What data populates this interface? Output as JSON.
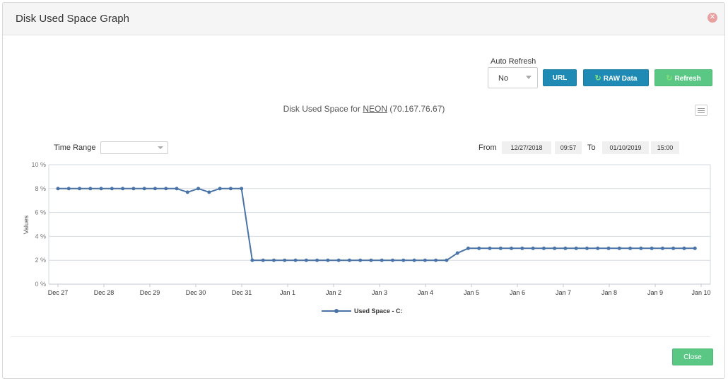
{
  "dialog": {
    "title": "Disk Used Space Graph",
    "close_icon": "close-circle-icon"
  },
  "auto_refresh": {
    "label": "Auto Refresh",
    "value": "No"
  },
  "buttons": {
    "url": "URL",
    "raw": "RAW Data",
    "refresh": "Refresh",
    "close": "Close"
  },
  "chart_header": {
    "prefix": "Disk Used Space for ",
    "host": "NEON",
    "ip": " (70.167.76.67)"
  },
  "time_range": {
    "label": "Time Range",
    "value": ""
  },
  "range": {
    "from_label": "From",
    "from_date": "12/27/2018",
    "from_time": "09:57",
    "to_label": "To",
    "to_date": "01/10/2019",
    "to_time": "15:00"
  },
  "colors": {
    "series": "#4a74a8",
    "primary": "#1f8bb4",
    "success": "#5bc785"
  },
  "chart_data": {
    "type": "line",
    "ylabel": "Values",
    "xlabel": "",
    "ylim": [
      0,
      10
    ],
    "yticks": [
      "0 %",
      "2 %",
      "4 %",
      "6 %",
      "8 %",
      "10 %"
    ],
    "yvalues": [
      0,
      2,
      4,
      6,
      8,
      10
    ],
    "xticks": [
      "Dec 27",
      "Dec 28",
      "Dec 29",
      "Dec 30",
      "Dec 31",
      "Jan 1",
      "Jan 2",
      "Jan 3",
      "Jan 4",
      "Jan 5",
      "Jan 6",
      "Jan 7",
      "Jan 8",
      "Jan 9",
      "Jan 10"
    ],
    "legend": "bottom-center",
    "series": [
      {
        "name": "Used Space - C:",
        "x": [
          0,
          0.235,
          0.47,
          0.705,
          0.94,
          1.175,
          1.41,
          1.645,
          1.88,
          2.115,
          2.35,
          2.585,
          2.82,
          3.055,
          3.29,
          3.525,
          3.76,
          3.995,
          4.23,
          4.465,
          4.7,
          4.935,
          5.17,
          5.405,
          5.64,
          5.875,
          6.11,
          6.345,
          6.58,
          6.815,
          7.05,
          7.285,
          7.52,
          7.755,
          7.99,
          8.225,
          8.46,
          8.695,
          8.93,
          9.165,
          9.4,
          9.635,
          9.87,
          10.105,
          10.34,
          10.575,
          10.81,
          11.045,
          11.28,
          11.515,
          11.75,
          11.985,
          12.22,
          12.455,
          12.69,
          12.925,
          13.16,
          13.395,
          13.63,
          13.865
        ],
        "values": [
          8,
          8,
          8,
          8,
          8,
          8,
          8,
          8,
          8,
          8,
          8,
          8,
          7.7,
          8,
          7.7,
          8,
          8,
          8,
          2,
          2,
          2,
          2,
          2,
          2,
          2,
          2,
          2,
          2,
          2,
          2,
          2,
          2,
          2,
          2,
          2,
          2,
          2,
          2.6,
          3,
          3,
          3,
          3,
          3,
          3,
          3,
          3,
          3,
          3,
          3,
          3,
          3,
          3,
          3,
          3,
          3,
          3,
          3,
          3,
          3,
          3
        ]
      }
    ]
  }
}
